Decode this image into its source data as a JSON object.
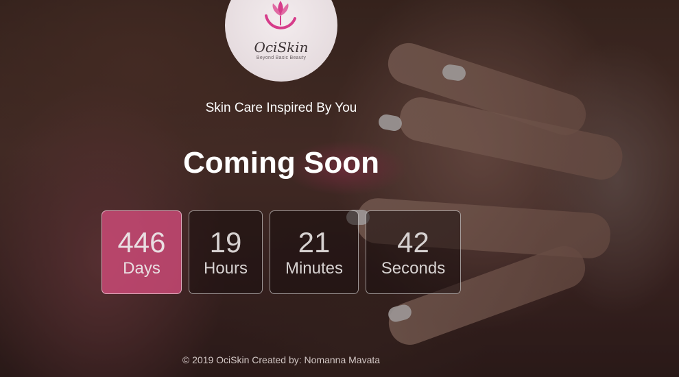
{
  "brand": {
    "name": "OciSkin",
    "tagline_small": "Beyond Basic Beauty",
    "accent_color": "#d63c8a"
  },
  "hero": {
    "tagline": "Skin Care Inspired By You",
    "headline": "Coming Soon"
  },
  "countdown": [
    {
      "value": "446",
      "unit": "Days"
    },
    {
      "value": "19",
      "unit": "Hours"
    },
    {
      "value": "21",
      "unit": "Minutes"
    },
    {
      "value": "42",
      "unit": "Seconds"
    }
  ],
  "footer": {
    "text": "© 2019 OciSkin Created by: Nomanna Mavata"
  }
}
